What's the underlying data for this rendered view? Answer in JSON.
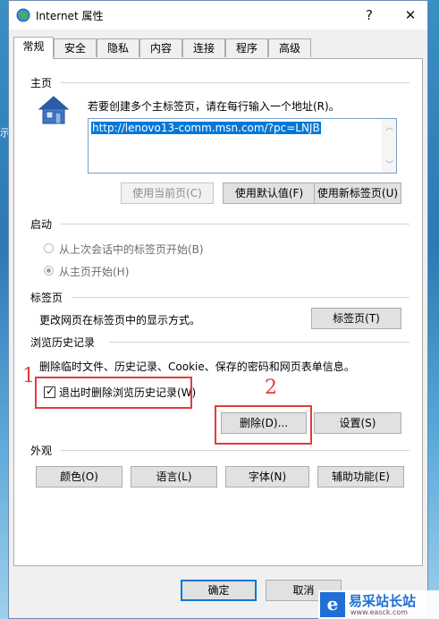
{
  "window": {
    "title": "Internet 属性",
    "help": "?",
    "close": "✕"
  },
  "tabs": [
    "常规",
    "安全",
    "隐私",
    "内容",
    "连接",
    "程序",
    "高级"
  ],
  "home": {
    "section": "主页",
    "hint": "若要创建多个主标签页，请在每行输入一个地址(R)。",
    "url": "http://lenovo13-comm.msn.com/?pc=LNJB",
    "btn_current": "使用当前页(C)",
    "btn_default": "使用默认值(F)",
    "btn_newtab": "使用新标签页(U)"
  },
  "startup": {
    "section": "启动",
    "opt_last": "从上次会话中的标签页开始(B)",
    "opt_home": "从主页开始(H)"
  },
  "tabsec": {
    "section": "标签页",
    "desc": "更改网页在标签页中的显示方式。",
    "btn": "标签页(T)"
  },
  "history": {
    "section": "浏览历史记录",
    "desc": "删除临时文件、历史记录、Cookie、保存的密码和网页表单信息。",
    "checkbox": "退出时删除浏览历史记录(W)",
    "btn_delete": "删除(D)...",
    "btn_settings": "设置(S)"
  },
  "appearance": {
    "section": "外观",
    "btn_colors": "颜色(O)",
    "btn_languages": "语言(L)",
    "btn_fonts": "字体(N)",
    "btn_access": "辅助功能(E)"
  },
  "footer": {
    "ok": "确定",
    "cancel": "取消"
  },
  "annotations": {
    "mark1": "1",
    "mark2": "2"
  },
  "watermark": {
    "brand": "易采站长站",
    "url": "www.easck.com",
    "mark": "e"
  },
  "colors": {
    "accent": "#0078d7",
    "highlight": "#e23b3b"
  }
}
